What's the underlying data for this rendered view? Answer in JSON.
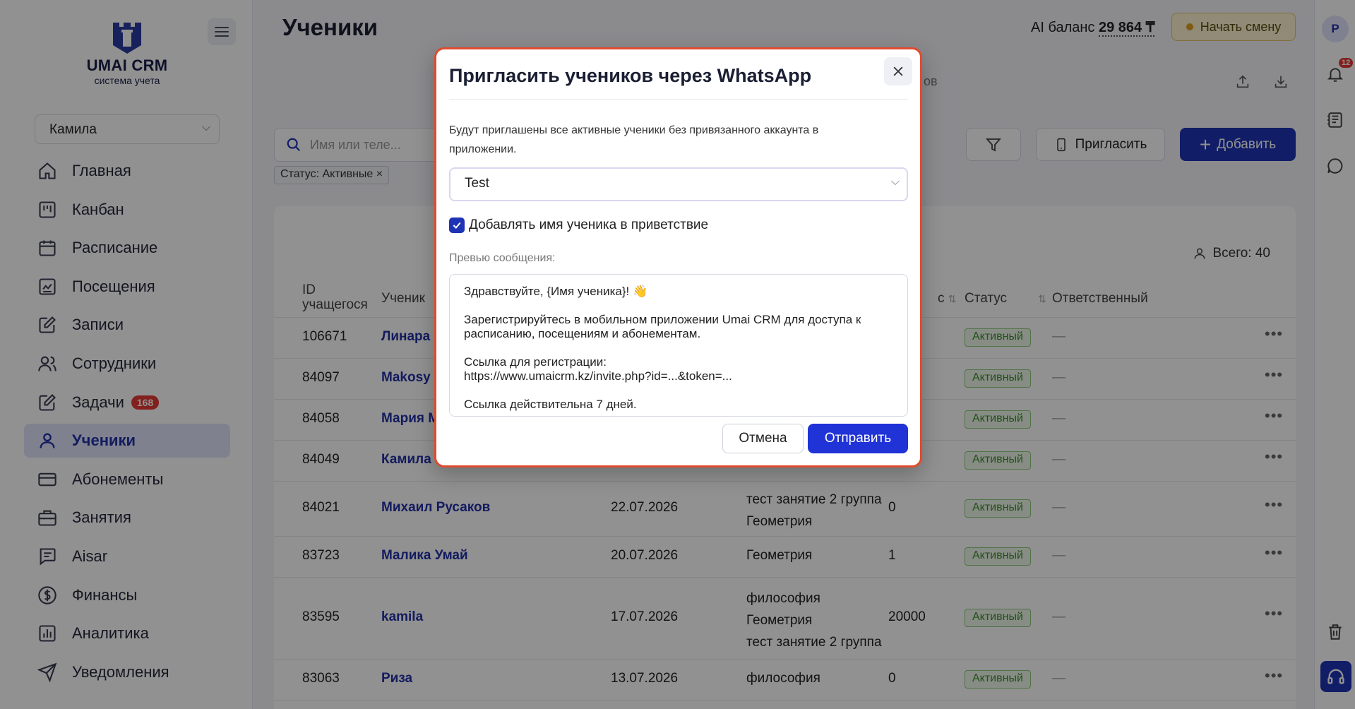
{
  "app": {
    "logo_title": "UMAI CRM",
    "logo_subtitle": "система учета"
  },
  "sidebar": {
    "user_select": "Камила",
    "items": [
      {
        "label": "Главная",
        "icon": "home-icon"
      },
      {
        "label": "Канбан",
        "icon": "kanban-icon"
      },
      {
        "label": "Расписание",
        "icon": "calendar-icon"
      },
      {
        "label": "Посещения",
        "icon": "attendance-icon"
      },
      {
        "label": "Записи",
        "icon": "edit-icon"
      },
      {
        "label": "Сотрудники",
        "icon": "staff-icon"
      },
      {
        "label": "Задачи",
        "icon": "tasks-icon",
        "badge": "168"
      },
      {
        "label": "Ученики",
        "icon": "user-icon",
        "active": true
      },
      {
        "label": "Абонементы",
        "icon": "card-icon"
      },
      {
        "label": "Занятия",
        "icon": "briefcase-icon"
      },
      {
        "label": "Aisar",
        "icon": "chat-icon"
      },
      {
        "label": "Финансы",
        "icon": "dollar-icon"
      },
      {
        "label": "Аналитика",
        "icon": "chart-icon"
      },
      {
        "label": "Уведомления",
        "icon": "send-icon"
      }
    ]
  },
  "header": {
    "title": "Ученики",
    "ai_balance_label": "AI баланс",
    "ai_balance_value": "29 864 ₸",
    "start_shift": "Начать смену",
    "tabs_faint": "ов"
  },
  "toolbar": {
    "search_placeholder": "Имя или теле...",
    "filter_chip": "Статус: Активные ×",
    "invite_label": "Пригласить",
    "add_label": "Добавить"
  },
  "table": {
    "total": "Всего: 40",
    "headers": {
      "id": "ID учащегося",
      "student": "Ученик",
      "balance": "с",
      "status": "Статус",
      "responsible": "Ответственный"
    },
    "rows": [
      {
        "id": "106671",
        "name": "Линара",
        "date": "",
        "lessons": [],
        "balance": "",
        "status": "Активный",
        "responsible": "—"
      },
      {
        "id": "84097",
        "name": "Makosy",
        "date": "",
        "lessons": [],
        "balance": "",
        "status": "Активный",
        "responsible": "—"
      },
      {
        "id": "84058",
        "name": "Мария М",
        "date": "",
        "lessons": [],
        "balance": "",
        "status": "Активный",
        "responsible": "—"
      },
      {
        "id": "84049",
        "name": "Камила",
        "date": "",
        "lessons": [],
        "balance": "",
        "status": "Активный",
        "responsible": "—"
      },
      {
        "id": "84021",
        "name": "Михаил Русаков",
        "date": "22.07.2026",
        "lessons": [
          "тест занятие 2 группа",
          "Геометрия"
        ],
        "balance": "0",
        "status": "Активный",
        "responsible": "—"
      },
      {
        "id": "83723",
        "name": "Малика Умай",
        "date": "20.07.2026",
        "lessons": [
          "Геометрия"
        ],
        "balance": "1",
        "status": "Активный",
        "responsible": "—"
      },
      {
        "id": "83595",
        "name": "kamila",
        "date": "17.07.2026",
        "lessons": [
          "философия",
          "Геометрия",
          "тест занятие 2 группа"
        ],
        "balance": "20000",
        "status": "Активный",
        "responsible": "—"
      },
      {
        "id": "83063",
        "name": "Риза",
        "date": "13.07.2026",
        "lessons": [
          "философия"
        ],
        "balance": "0",
        "status": "Активный",
        "responsible": "—"
      }
    ]
  },
  "rail": {
    "avatar": "Р",
    "notifications": "12"
  },
  "modal": {
    "title": "Пригласить учеников через WhatsApp",
    "description": "Будут приглашены все активные ученики без привязанного аккаунта в приложении.",
    "template_value": "Test",
    "checkbox_label": "Добавлять имя ученика в приветствие",
    "preview_label": "Превью сообщения:",
    "preview_text": "Здравствуйте, {Имя ученика}! 👋\n\nЗарегистрируйтесь в мобильном приложении Umai CRM для доступа к расписанию, посещениям и абонементам.\n\nСсылка для регистрации:\nhttps://www.umaicrm.kz/invite.php?id=...&token=...\n\nСсылка действительна 7 дней.",
    "cancel_label": "Отмена",
    "send_label": "Отправить"
  },
  "colors": {
    "accent": "#1f33b5",
    "modal_border": "#e04b2e",
    "status_green": "#3f8c2e",
    "badge_red": "#e53935"
  }
}
